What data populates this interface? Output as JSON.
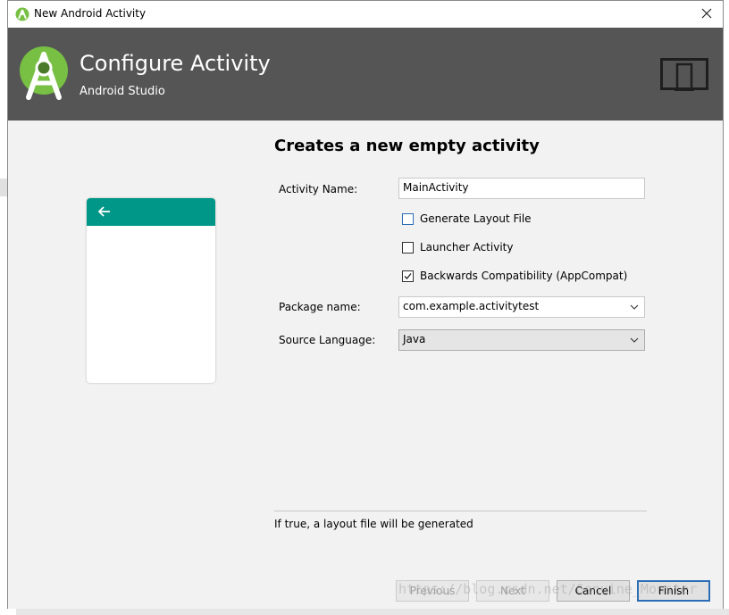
{
  "window": {
    "title": "New Android Activity"
  },
  "header": {
    "title": "Configure Activity",
    "subtitle": "Android Studio"
  },
  "main": {
    "heading": "Creates a new empty activity",
    "activity_name": {
      "label": "Activity Name:",
      "value": "MainActivity"
    },
    "generate_layout": {
      "label": "Generate Layout File",
      "checked": false
    },
    "launcher_activity": {
      "label": "Launcher Activity",
      "checked": false
    },
    "backwards_compat": {
      "label": "Backwards Compatibility (AppCompat)",
      "checked": true
    },
    "package_name": {
      "label": "Package name:",
      "value": "com.example.activitytest"
    },
    "source_language": {
      "label": "Source Language:",
      "value": "Java"
    },
    "hint": "If true, a layout file will be generated"
  },
  "buttons": {
    "previous": "Previous",
    "next": "Next",
    "cancel": "Cancel",
    "finish": "Finish"
  },
  "watermark": "https://blog.csdn.net/Genuine_Monster",
  "colors": {
    "header_bg": "#555555",
    "toolbar": "#009688",
    "logo_green": "#77c043",
    "focus": "#2c6db5"
  }
}
